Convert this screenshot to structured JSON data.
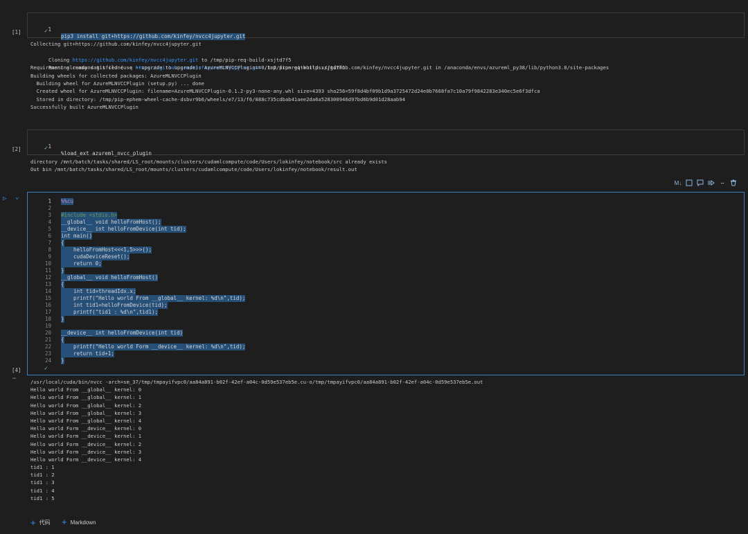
{
  "cells": [
    {
      "exec_count": "[1]",
      "lines": [
        [
          "1",
          "pip3 install git+https://github.com/kinfey/nvcc4jupyter.git"
        ]
      ],
      "output": [
        "Collecting git+https://github.com/kinfey/nvcc4jupyter.git",
        "  Cloning https://github.com/kinfey/nvcc4jupyter.git to /tmp/pip-req-build-xsjtd7f5",
        "  Running command git clone -q https://github.com/kinfey/nvcc4jupyter.git /tmp/pip-req-build-xsjtd7f5",
        "Requirement already satisfied (use --upgrade to upgrade): AzureMLNVCCPlugin==0.1.2 from git+https://github.com/kinfey/nvcc4jupyter.git in /anaconda/envs/azureml_py38/lib/python3.8/site-packages",
        "Building wheels for collected packages: AzureMLNVCCPlugin",
        "  Building wheel for AzureMLNVCCPlugin (setup.py) ... done",
        "  Created wheel for AzureMLNVCCPlugin: filename=AzureMLNVCCPlugin-0.1.2-py3-none-any.whl size=4393 sha256=59f8d4bf09b1d9a3725472d24e0b7668fa7c10a79f9842283e340ec5e6f3dfca",
        "  Stored in directory: /tmp/pip-ephem-wheel-cache-dsbvr9b6/wheels/e7/13/f6/888c735cdbab41aee2da6a528300946d97bd6b9d01d28aab94",
        "Successfully built AzureMLNVCCPlugin"
      ]
    },
    {
      "exec_count": "[2]",
      "lines": [
        [
          "1",
          "%load_ext azureml_nvcc_plugin"
        ]
      ],
      "output": [
        "directory /mnt/batch/tasks/shared/LS_root/mounts/clusters/cudamlcompute/code/Users/lokinfey/notebook/src already exists",
        "Out bin /mnt/batch/tasks/shared/LS_root/mounts/clusters/cudamlcompute/code/Users/lokinfey/notebook/result.out"
      ]
    },
    {
      "exec_count": "[4]",
      "lines": [
        [
          "1",
          "%%cu"
        ],
        [
          "2",
          ""
        ],
        [
          "3",
          "#include <stdio.h>"
        ],
        [
          "4",
          "__global__ void helloFromHost();"
        ],
        [
          "5",
          "__device__ int helloFromDevice(int tid);"
        ],
        [
          "6",
          "int main()"
        ],
        [
          "7",
          "{"
        ],
        [
          "8",
          "    helloFromHost<<<1,5>>>();"
        ],
        [
          "9",
          "    cudaDeviceReset();"
        ],
        [
          "10",
          "    return 0;"
        ],
        [
          "11",
          "}"
        ],
        [
          "12",
          "__global__ void helloFromHost()"
        ],
        [
          "13",
          "{"
        ],
        [
          "14",
          "    int tid=threadIdx.x;"
        ],
        [
          "15",
          "    printf(\"Hello world From __global__ kernel: %d\\n\",tid);"
        ],
        [
          "16",
          "    int tid1=helloFromDevice(tid);"
        ],
        [
          "17",
          "    printf(\"tid1 : %d\\n\",tid1);"
        ],
        [
          "18",
          "}"
        ],
        [
          "19",
          ""
        ],
        [
          "20",
          "__device__ int helloFromDevice(int tid)"
        ],
        [
          "21",
          "{"
        ],
        [
          "22",
          "    printf(\"Hello world Form __device__ kernel: %d\\n\",tid);"
        ],
        [
          "23",
          "    return tid+1;"
        ],
        [
          "24",
          "}"
        ]
      ],
      "output": [
        "/usr/local/cuda/bin/nvcc -arch=sm_37/tmp/tmpayifvpc0/aa84a891-b02f-42ef-a04c-0d59e537eb5e.cu-o/tmp/tmpayifvpc0/aa84a891-b02f-42ef-a04c-0d59e537eb5e.out",
        "Hello world From __global__ kernel: 0",
        "Hello world From __global__ kernel: 1",
        "Hello world From __global__ kernel: 2",
        "Hello world From __global__ kernel: 3",
        "Hello world From __global__ kernel: 4",
        "Hello world Form __device__ kernel: 0",
        "Hello world Form __device__ kernel: 1",
        "Hello world Form __device__ kernel: 2",
        "Hello world Form __device__ kernel: 3",
        "Hello world Form __device__ kernel: 4",
        "tid1 : 1",
        "tid1 : 2",
        "tid1 : 3",
        "tid1 : 4",
        "tid1 : 5"
      ]
    }
  ],
  "toolbar": {
    "markdown_label": "M↓",
    "icons": [
      "split-cell-icon",
      "comment-icon",
      "more-actions-icon",
      "delete-icon"
    ]
  },
  "footer": {
    "add_code_label": "代码",
    "add_markdown_label": "Markdown"
  },
  "colors": {
    "active_border": "#3b7fc4",
    "selection": "#264f78",
    "success_check": "#89d185",
    "link": "#3794ff"
  }
}
